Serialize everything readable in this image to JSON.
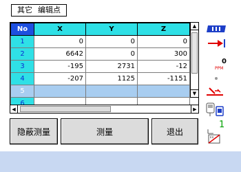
{
  "menu": {
    "items": [
      "其它",
      "编辑点"
    ]
  },
  "table": {
    "headers": [
      "No",
      "X",
      "Y",
      "Z"
    ],
    "rows": [
      {
        "no": "1",
        "x": "0",
        "y": "0",
        "z": "0"
      },
      {
        "no": "2",
        "x": "6642",
        "y": "0",
        "z": "300"
      },
      {
        "no": "3",
        "x": "-195",
        "y": "2731",
        "z": "-12"
      },
      {
        "no": "4",
        "x": "-207",
        "y": "1125",
        "z": "-1151"
      },
      {
        "no": "5",
        "x": "",
        "y": "",
        "z": ""
      },
      {
        "no": "6",
        "x": "",
        "y": "",
        "z": ""
      }
    ],
    "selected_row": 5
  },
  "status": {
    "ppm_value": "0",
    "ppm_label": "PPM",
    "face_number": "1",
    "battery_color": "#1d3fc8",
    "accent_red": "#e00000",
    "face_green": "#00a000"
  },
  "buttons": {
    "hide_measure": "隐蔽测量",
    "measure": "测量",
    "exit": "退出"
  },
  "colors": {
    "header_cyan": "#2fe0e6",
    "no_header_blue": "#1d4fe0",
    "selected_row": "#a8cdf0",
    "bottom_band": "#c8d8f2",
    "button_gray": "#dcdcdc"
  }
}
